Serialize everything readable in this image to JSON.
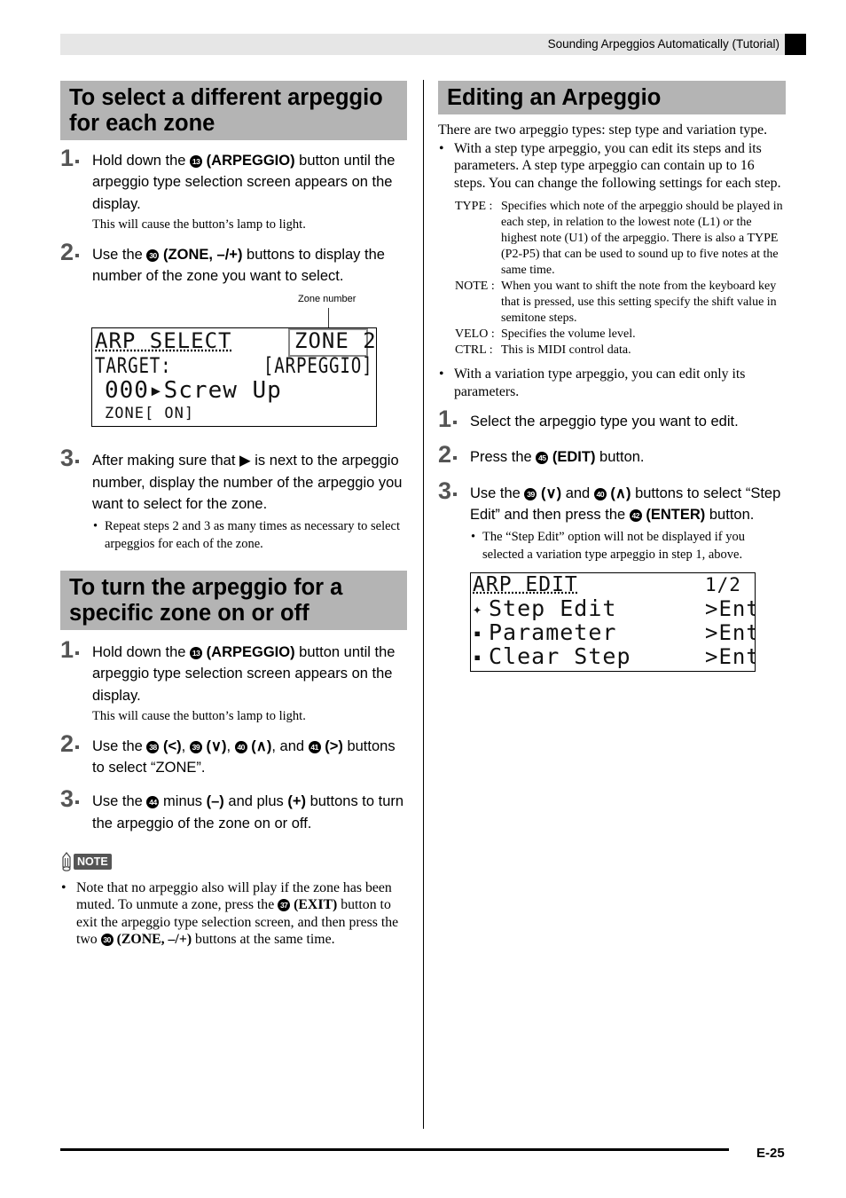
{
  "header": {
    "title": "Sounding Arpeggios Automatically (Tutorial)"
  },
  "left": {
    "section1": {
      "title_line1": "To select a different arpeggio",
      "title_line2": "for each zone",
      "steps": [
        {
          "num": "1",
          "pre": "Hold down the ",
          "btn": "13",
          "bold": "(ARPEGGIO)",
          "post": " button until the arpeggio type selection screen appears on the display.",
          "sub": "This will cause the button’s lamp to light."
        },
        {
          "num": "2",
          "pre": "Use the ",
          "btn": "30",
          "bold": "(ZONE, –/+)",
          "post": " buttons to display the number of the zone you want to select."
        },
        {
          "num": "3",
          "text": "After making sure that ▶ is next to the arpeggio number, display the number of the arpeggio you want to select for the zone.",
          "bullet": "Repeat steps 2 and 3 as many times as necessary to select arpeggios for each of the zone."
        }
      ],
      "callout": "Zone number",
      "lcd": {
        "line1_left": "ARP SELECT",
        "line1_right": "ZONE 2",
        "line2_left": "TARGET:",
        "line2_right": "[ARPEGGIO]",
        "line3": "000▸Screw Up",
        "line4": "ZONE[ ON]"
      }
    },
    "section2": {
      "title_line1": "To turn the arpeggio for a",
      "title_line2": "specific zone on or off",
      "steps": [
        {
          "num": "1",
          "pre": "Hold down the ",
          "btn": "13",
          "bold": "(ARPEGGIO)",
          "post": " button until the arpeggio type selection screen appears on the display.",
          "sub": "This will cause the button’s lamp to light."
        },
        {
          "num": "2",
          "pre": "Use the ",
          "b1": "38",
          "s1": "(<)",
          "b2": "39",
          "s2": "(∨)",
          "b3": "40",
          "s3": "(∧)",
          "and": ", and ",
          "b4": "41",
          "s4": "(>)",
          "post": " buttons to select “ZONE”."
        },
        {
          "num": "3",
          "pre": "Use the ",
          "btn": "44",
          "mid1": " minus ",
          "bold1": "(–)",
          "mid2": " and plus ",
          "bold2": "(+)",
          "post": " buttons to turn the arpeggio of the zone on or off."
        }
      ]
    },
    "note": {
      "label": "NOTE",
      "pre": "Note that no arpeggio also will play if the zone has been muted. To unmute a zone, press the ",
      "btn1": "37",
      "bold1": "(EXIT)",
      "mid": " button to exit the arpeggio type selection screen, and then press the two ",
      "btn2": "30",
      "bold2": "(ZONE, –/+)",
      "post": " buttons at the same time."
    }
  },
  "right": {
    "title": "Editing an Arpeggio",
    "intro": "There are two arpeggio types: step type and variation type.",
    "bullet1": "With a step type arpeggio, you can edit its steps and its parameters. A step type arpeggio can contain up to 16 steps. You can change the following settings for each step.",
    "definitions": [
      {
        "key": "TYPE  :",
        "value": "Specifies which note of the arpeggio should be played in each step, in relation to the lowest note (L1) or the highest note (U1) of the arpeggio. There is also a TYPE (P2-P5) that can be used to sound up to five notes at the same time."
      },
      {
        "key": "NOTE :",
        "value": "When you want to shift the note from the keyboard key that is pressed, use this setting specify the shift value in semitone steps."
      },
      {
        "key": "VELO :",
        "value": "Specifies the volume level."
      },
      {
        "key": "CTRL  :",
        "value": "This is MIDI control data."
      }
    ],
    "bullet2": "With a variation type arpeggio, you can edit only its parameters.",
    "steps": [
      {
        "num": "1",
        "text": "Select the arpeggio type you want to edit."
      },
      {
        "num": "2",
        "pre": "Press the ",
        "btn": "45",
        "bold": "(EDIT)",
        "post": " button."
      },
      {
        "num": "3",
        "pre": "Use the ",
        "b1": "39",
        "s1": "(∨)",
        "mid1": " and ",
        "b2": "40",
        "s2": "(∧)",
        "mid2": " buttons to select “Step Edit” and then press the ",
        "b3": "42",
        "s3": "(ENTER)",
        "post": " button.",
        "bullet": "The “Step Edit” option will not be displayed if you selected a variation type arpeggio in step 1, above."
      }
    ],
    "lcd": {
      "line1_left": "ARP EDIT",
      "line1_right": "1/2",
      "items": [
        {
          "marker": "✦",
          "label": "Step Edit",
          "action": ">Ent"
        },
        {
          "marker": "▪",
          "label": "Parameter",
          "action": ">Ent"
        },
        {
          "marker": "▪",
          "label": "Clear Step",
          "action": ">Ent"
        }
      ]
    }
  },
  "footer": {
    "page": "E-25"
  }
}
